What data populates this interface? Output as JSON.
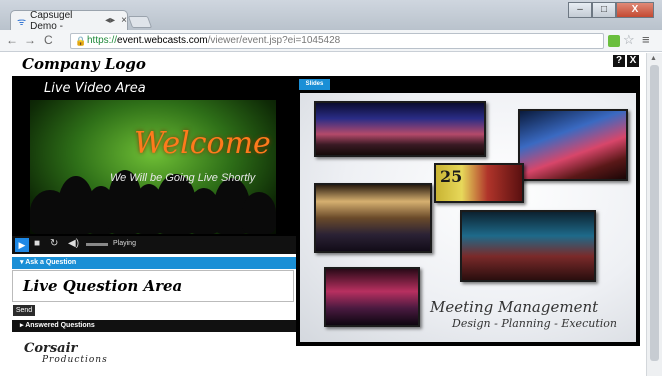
{
  "browser": {
    "tab_title": "Capsugel Demo -",
    "tab_extra_glyph": "◂▸",
    "url_scheme": "https://",
    "url_host": "event.webcasts.com",
    "url_path": "/viewer/event.jsp?ei=1045428",
    "window_buttons": {
      "minimize": "–",
      "maximize": "□",
      "close": "X"
    }
  },
  "header": {
    "logo": "Company Logo",
    "help_label": "?",
    "close_label": "X"
  },
  "video": {
    "label": "Live Video Area",
    "welcome": "Welcome",
    "subtitle": "We Will be Going Live Shortly",
    "status": "Playing"
  },
  "question": {
    "ask_label": "▾ Ask a Question",
    "placeholder_text": "Live Question Area",
    "send_label": "Send",
    "answered_label": "▸ Answered Questions"
  },
  "footer": {
    "brand": "Corsair",
    "brand_sub": "Productions"
  },
  "slides": {
    "tab_label": "Slides",
    "badge": "25",
    "title": "Meeting Management",
    "subtitle": "Design - Planning - Execution"
  }
}
